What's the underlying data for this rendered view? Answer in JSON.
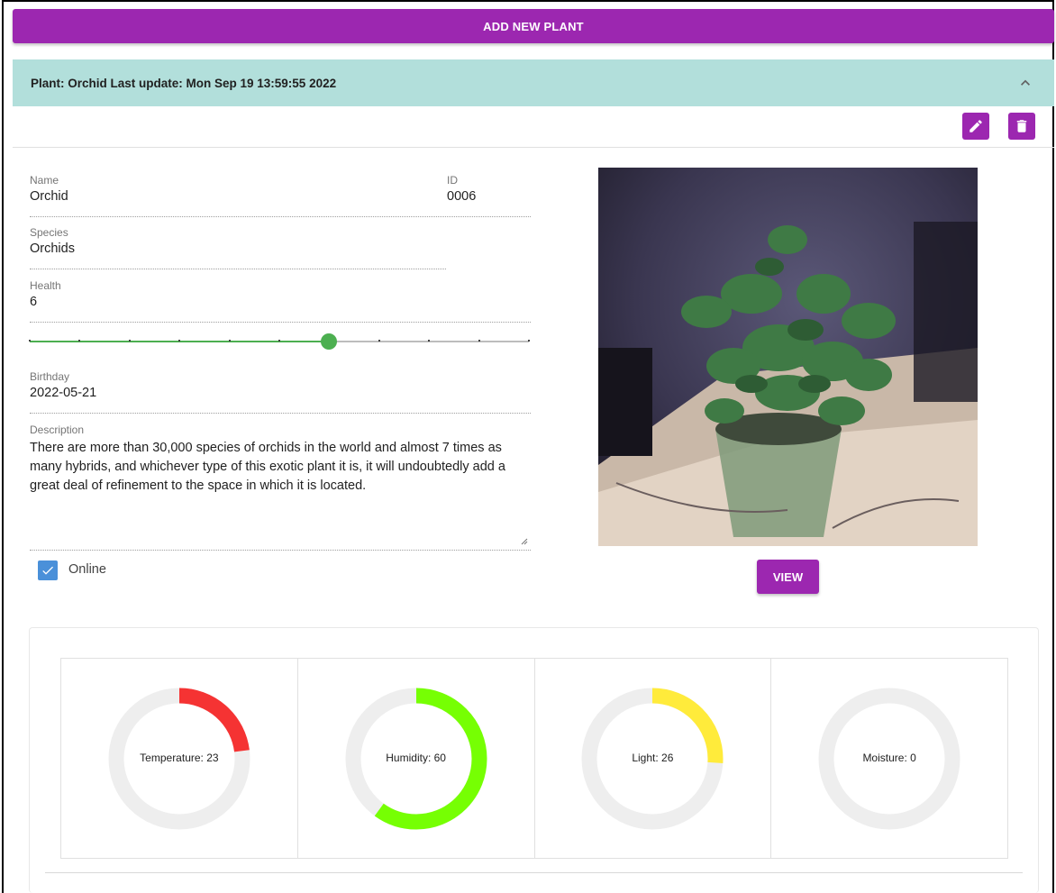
{
  "toolbar": {
    "add_label": "ADD NEW PLANT"
  },
  "panel": {
    "title": "Plant: Orchid Last update: Mon Sep 19 13:59:55 2022",
    "edit_icon": "pencil-icon",
    "delete_icon": "trash-icon"
  },
  "fields": {
    "name": {
      "label": "Name",
      "value": "Orchid"
    },
    "id": {
      "label": "ID",
      "value": "0006"
    },
    "species": {
      "label": "Species",
      "value": "Orchids"
    },
    "health": {
      "label": "Health",
      "value": "6",
      "max": 10
    },
    "birthday": {
      "label": "Birthday",
      "value": "2022-05-21"
    },
    "description": {
      "label": "Description",
      "value": "There are more than 30,000 species of orchids in the world and almost 7 times as many hybrids, and whichever type of this exotic plant it is, it will undoubtedly add a great deal of refinement to the space in which it is located."
    },
    "online": {
      "label": "Online",
      "checked": true
    }
  },
  "photo": {
    "view_label": "VIEW"
  },
  "gauges": [
    {
      "label": "Temperature: 23",
      "value": 23,
      "color": "#f53333"
    },
    {
      "label": "Humidity: 60",
      "value": 60,
      "color": "#76ff03"
    },
    {
      "label": "Light: 26",
      "value": 26,
      "color": "#ffeb3b"
    },
    {
      "label": "Moisture: 0",
      "value": 0,
      "color": "#9e9e9e"
    }
  ],
  "colors": {
    "accent": "#9c27b0",
    "header": "#b2dfdb",
    "slider": "#4caf50",
    "checkbox": "#4a90d9"
  }
}
